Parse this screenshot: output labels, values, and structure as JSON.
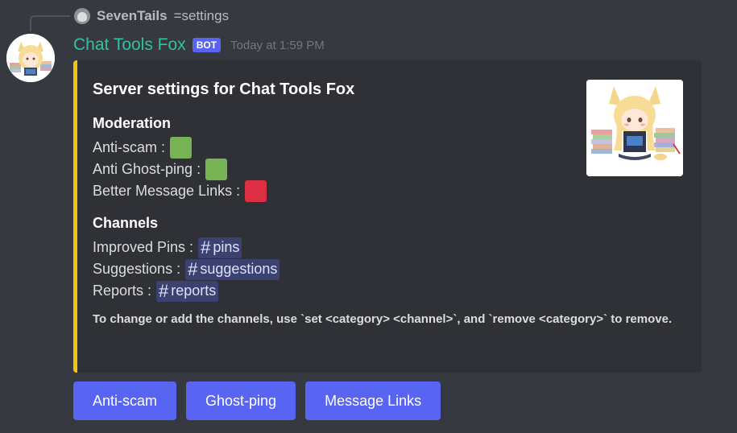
{
  "reply": {
    "author": "SevenTails",
    "text": "=settings"
  },
  "message": {
    "author": "Chat Tools Fox",
    "bot_tag": "BOT",
    "timestamp": "Today at 1:59 PM"
  },
  "embed": {
    "accent_color": "#f1c40f",
    "title": "Server settings for Chat Tools Fox",
    "moderation": {
      "name": "Moderation",
      "items": [
        {
          "label": "Anti-scam :",
          "state": "on",
          "color": "#77b255"
        },
        {
          "label": "Anti Ghost-ping :",
          "state": "on",
          "color": "#77b255"
        },
        {
          "label": "Better Message Links :",
          "state": "off",
          "color": "#dd2e44"
        }
      ]
    },
    "channels": {
      "name": "Channels",
      "items": [
        {
          "label": "Improved Pins :",
          "channel": "pins"
        },
        {
          "label": "Suggestions :",
          "channel": "suggestions"
        },
        {
          "label": "Reports :",
          "channel": "reports"
        }
      ]
    },
    "footer": "To change or add the channels, use `set <category> <channel>`, and `remove <category>` to remove."
  },
  "buttons": [
    {
      "label": "Anti-scam"
    },
    {
      "label": "Ghost-ping"
    },
    {
      "label": "Message Links"
    }
  ],
  "channel_hash": "#"
}
